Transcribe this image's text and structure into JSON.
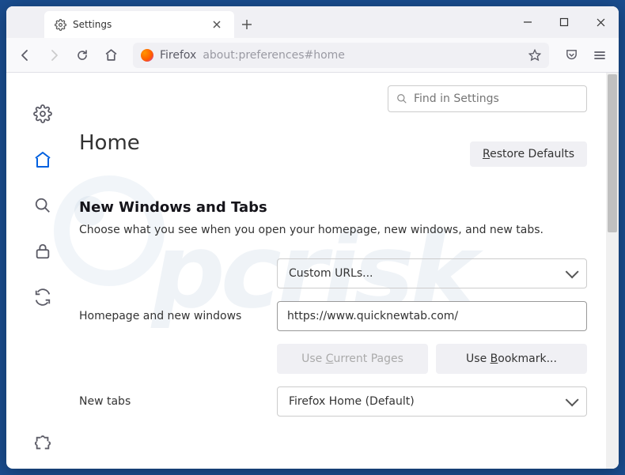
{
  "tab": {
    "label": "Settings"
  },
  "urlbar": {
    "prefix": "Firefox",
    "path": "about:preferences#home"
  },
  "search": {
    "placeholder": "Find in Settings"
  },
  "page": {
    "title": "Home",
    "restore": "Restore Defaults",
    "section_heading": "New Windows and Tabs",
    "section_desc": "Choose what you see when you open your homepage, new windows, and new tabs."
  },
  "homepage": {
    "label": "Homepage and new windows",
    "mode": "Custom URLs...",
    "url": "https://www.quicknewtab.com/",
    "use_current": "Use Current Pages",
    "use_bookmark": "Use Bookmark..."
  },
  "newtabs": {
    "label": "New tabs",
    "mode": "Firefox Home (Default)"
  },
  "watermark": "pcrisk"
}
